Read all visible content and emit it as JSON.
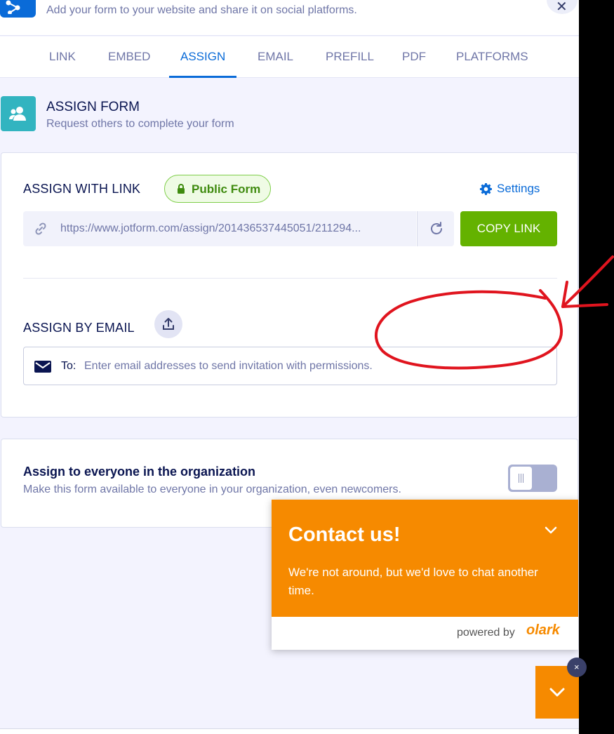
{
  "header": {
    "subtitle": "Add your form to your website and share it on social platforms.",
    "close_symbol": "✕",
    "share_icon": "share-icon"
  },
  "tabs": [
    {
      "label": "LINK"
    },
    {
      "label": "EMBED"
    },
    {
      "label": "ASSIGN",
      "active": true
    },
    {
      "label": "EMAIL"
    },
    {
      "label": "PREFILL"
    },
    {
      "label": "PDF"
    },
    {
      "label": "PLATFORMS"
    }
  ],
  "section": {
    "title": "ASSIGN FORM",
    "subtitle": "Request others to complete your form"
  },
  "assign_link": {
    "label": "ASSIGN WITH LINK",
    "badge": "Public Form",
    "settings_label": "Settings",
    "url": "https://www.jotform.com/assign/201436537445051/211294...",
    "copy_label": "COPY LINK"
  },
  "assign_email": {
    "label": "ASSIGN BY EMAIL",
    "to_label": "To:",
    "placeholder": "Enter email addresses to send invitation with permissions."
  },
  "organization": {
    "title": "Assign to everyone in the organization",
    "subtitle": "Make this form available to everyone in your organization, even newcomers.",
    "toggle_on": false
  },
  "chat": {
    "title": "Contact us!",
    "message": "We're not around, but we'd love to chat another time.",
    "powered_by": "powered by",
    "brand": "olark",
    "close_symbol": "×"
  },
  "colors": {
    "accent": "#0a6bd8",
    "success": "#64b200",
    "chat": "#f68a00",
    "annotation": "#e0141e"
  }
}
